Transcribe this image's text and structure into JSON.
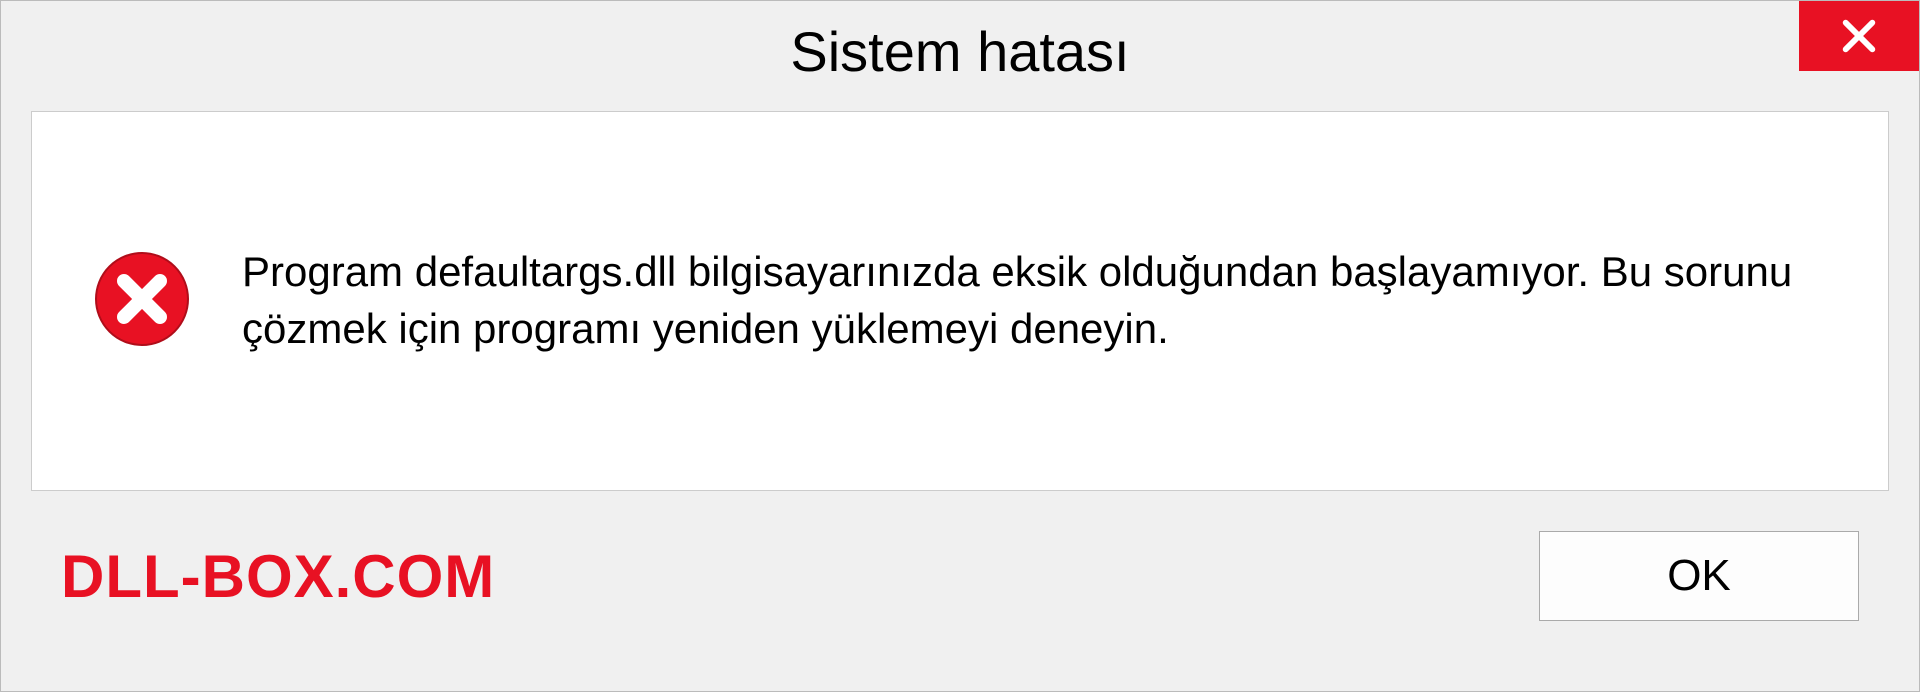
{
  "dialog": {
    "title": "Sistem hatası",
    "message": "Program defaultargs.dll bilgisayarınızda eksik olduğundan başlayamıyor. Bu sorunu çözmek için programı yeniden yüklemeyi deneyin.",
    "brand": "DLL-BOX.COM",
    "ok_label": "OK"
  }
}
